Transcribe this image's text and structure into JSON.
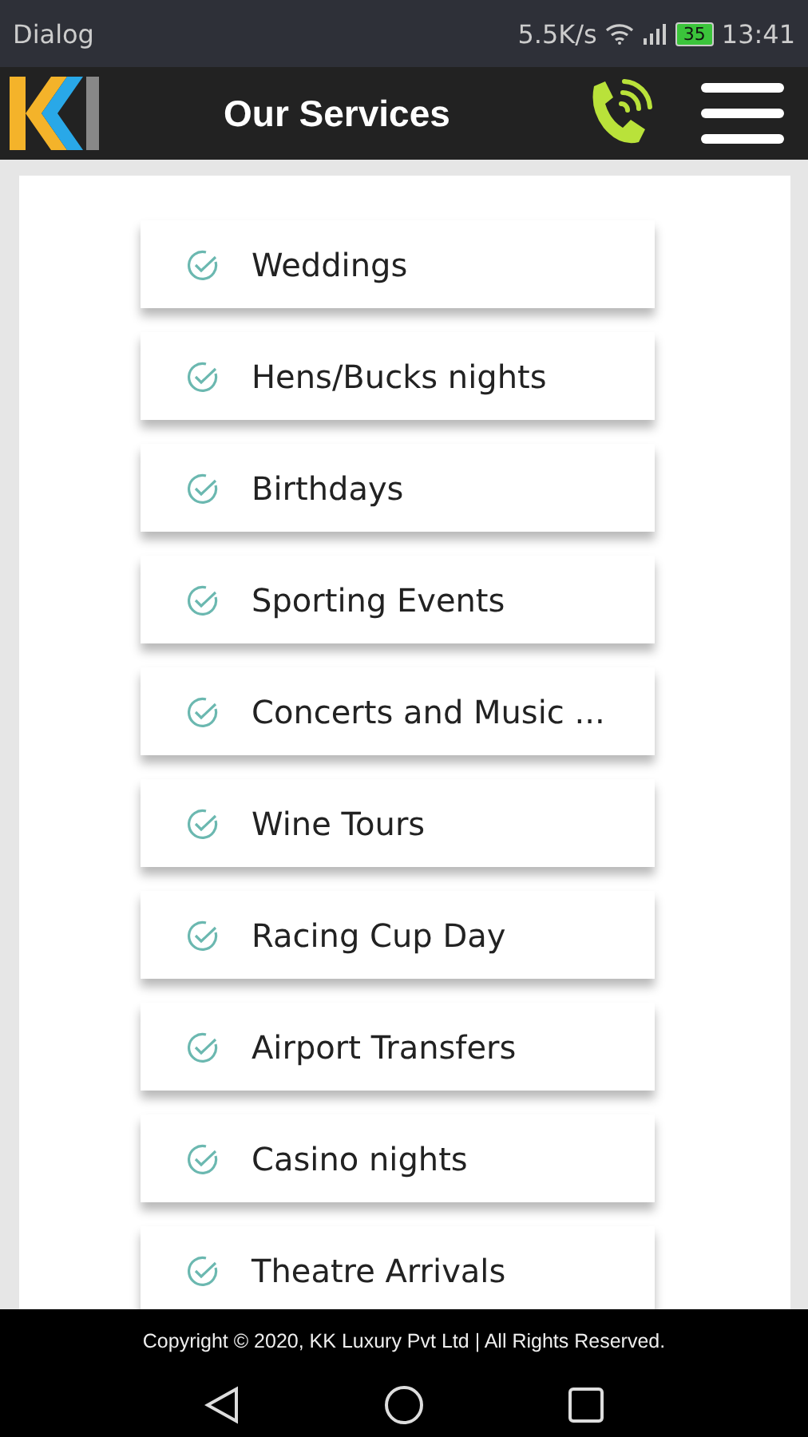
{
  "status_bar": {
    "app": "Dialog",
    "speed": "5.5K/s",
    "battery": "35",
    "time": "13:41"
  },
  "header": {
    "title": "Our Services"
  },
  "services": [
    {
      "label": "Weddings"
    },
    {
      "label": "Hens/Bucks nights"
    },
    {
      "label": "Birthdays"
    },
    {
      "label": "Sporting Events"
    },
    {
      "label": "Concerts and Music ..."
    },
    {
      "label": "Wine Tours"
    },
    {
      "label": "Racing Cup Day"
    },
    {
      "label": "Airport Transfers"
    },
    {
      "label": "Casino nights"
    },
    {
      "label": "Theatre Arrivals"
    }
  ],
  "footer": {
    "copyright": "Copyright © 2020, KK Luxury Pvt Ltd | All Rights Reserved."
  }
}
